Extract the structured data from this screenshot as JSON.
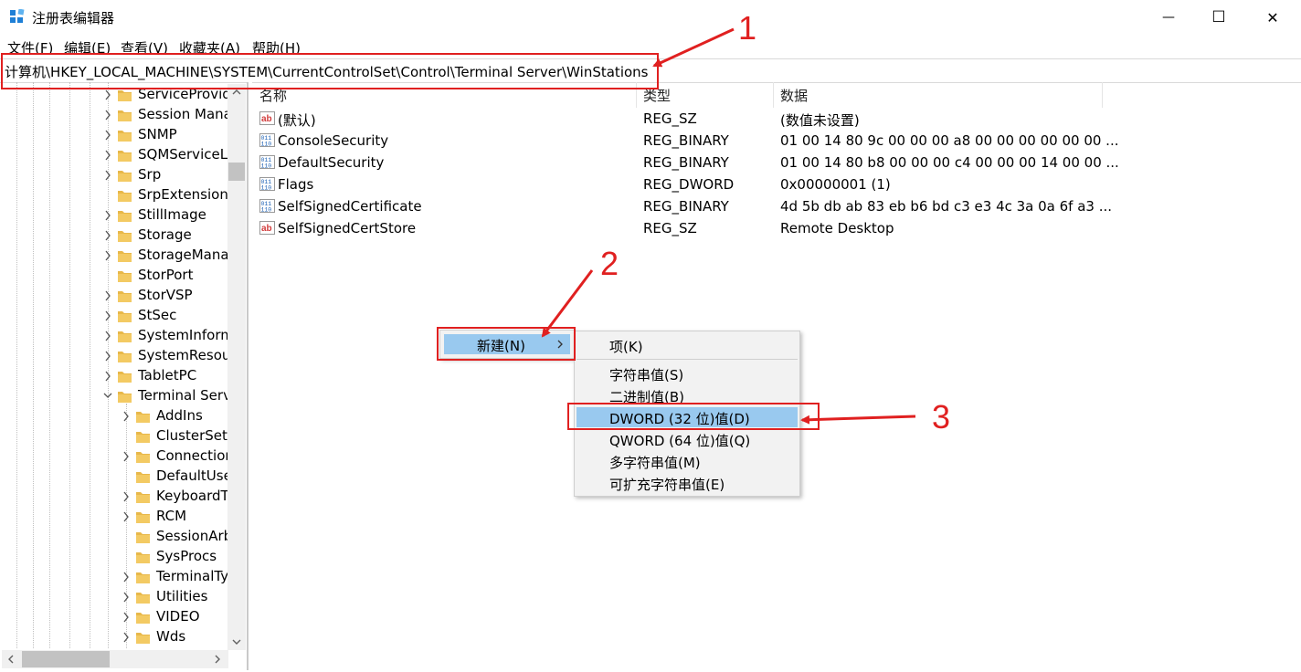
{
  "window": {
    "title": "注册表编辑器",
    "controls": {
      "minimize": "—",
      "maximize": "☐",
      "close": "✕"
    }
  },
  "menu": [
    "文件(F)",
    "编辑(E)",
    "查看(V)",
    "收藏夹(A)",
    "帮助(H)"
  ],
  "address": "计算机\\HKEY_LOCAL_MACHINE\\SYSTEM\\CurrentControlSet\\Control\\Terminal Server\\WinStations",
  "tree": {
    "items": [
      {
        "label": "ServiceProvid",
        "level": 1,
        "expander": "collapsed"
      },
      {
        "label": "Session Mana",
        "level": 1,
        "expander": "collapsed"
      },
      {
        "label": "SNMP",
        "level": 1,
        "expander": "collapsed"
      },
      {
        "label": "SQMServiceL",
        "level": 1,
        "expander": "collapsed"
      },
      {
        "label": "Srp",
        "level": 1,
        "expander": "collapsed"
      },
      {
        "label": "SrpExtension(",
        "level": 1,
        "expander": "none"
      },
      {
        "label": "StillImage",
        "level": 1,
        "expander": "collapsed"
      },
      {
        "label": "Storage",
        "level": 1,
        "expander": "collapsed"
      },
      {
        "label": "StorageMana",
        "level": 1,
        "expander": "collapsed"
      },
      {
        "label": "StorPort",
        "level": 1,
        "expander": "none"
      },
      {
        "label": "StorVSP",
        "level": 1,
        "expander": "collapsed"
      },
      {
        "label": "StSec",
        "level": 1,
        "expander": "collapsed"
      },
      {
        "label": "SystemInform",
        "level": 1,
        "expander": "collapsed"
      },
      {
        "label": "SystemResou",
        "level": 1,
        "expander": "collapsed"
      },
      {
        "label": "TabletPC",
        "level": 1,
        "expander": "collapsed"
      },
      {
        "label": "Terminal Serv",
        "level": 1,
        "expander": "expanded"
      },
      {
        "label": "AddIns",
        "level": 2,
        "expander": "collapsed"
      },
      {
        "label": "ClusterSet",
        "level": 2,
        "expander": "none"
      },
      {
        "label": "Connection",
        "level": 2,
        "expander": "collapsed"
      },
      {
        "label": "DefaultUse",
        "level": 2,
        "expander": "none"
      },
      {
        "label": "KeyboardT",
        "level": 2,
        "expander": "collapsed"
      },
      {
        "label": "RCM",
        "level": 2,
        "expander": "collapsed"
      },
      {
        "label": "SessionArb",
        "level": 2,
        "expander": "none"
      },
      {
        "label": "SysProcs",
        "level": 2,
        "expander": "none"
      },
      {
        "label": "TerminalTy",
        "level": 2,
        "expander": "collapsed"
      },
      {
        "label": "Utilities",
        "level": 2,
        "expander": "collapsed"
      },
      {
        "label": "VIDEO",
        "level": 2,
        "expander": "collapsed"
      },
      {
        "label": "Wds",
        "level": 2,
        "expander": "collapsed"
      }
    ]
  },
  "list": {
    "headers": {
      "name": "名称",
      "type": "类型",
      "data": "数据"
    },
    "rows": [
      {
        "icon": "string-value-icon",
        "name": "(默认)",
        "type": "REG_SZ",
        "data": "(数值未设置)"
      },
      {
        "icon": "binary-value-icon",
        "name": "ConsoleSecurity",
        "type": "REG_BINARY",
        "data": "01 00 14 80 9c 00 00 00 a8 00 00 00 00 00 00 ..."
      },
      {
        "icon": "binary-value-icon",
        "name": "DefaultSecurity",
        "type": "REG_BINARY",
        "data": "01 00 14 80 b8 00 00 00 c4 00 00 00 14 00 00 ..."
      },
      {
        "icon": "binary-value-icon",
        "name": "Flags",
        "type": "REG_DWORD",
        "data": "0x00000001 (1)"
      },
      {
        "icon": "binary-value-icon",
        "name": "SelfSignedCertificate",
        "type": "REG_BINARY",
        "data": "4d 5b db ab 83 eb b6 bd c3 e3 4c 3a 0a 6f a3 ..."
      },
      {
        "icon": "string-value-icon",
        "name": "SelfSignedCertStore",
        "type": "REG_SZ",
        "data": "Remote Desktop"
      }
    ]
  },
  "context_menu": {
    "new_label": "新建(N)",
    "submenu": {
      "key": "项(K)",
      "items": [
        "字符串值(S)",
        "二进制值(B)",
        "DWORD (32 位)值(D)",
        "QWORD (64 位)值(Q)",
        "多字符串值(M)",
        "可扩充字符串值(E)"
      ],
      "highlighted_index": 2
    }
  },
  "annotations": [
    "1",
    "2",
    "3"
  ],
  "colors": {
    "annotation": "#e02020",
    "highlight": "#99c9ef",
    "folder": "#e8b84a",
    "menu_bg": "#f2f2f2"
  }
}
